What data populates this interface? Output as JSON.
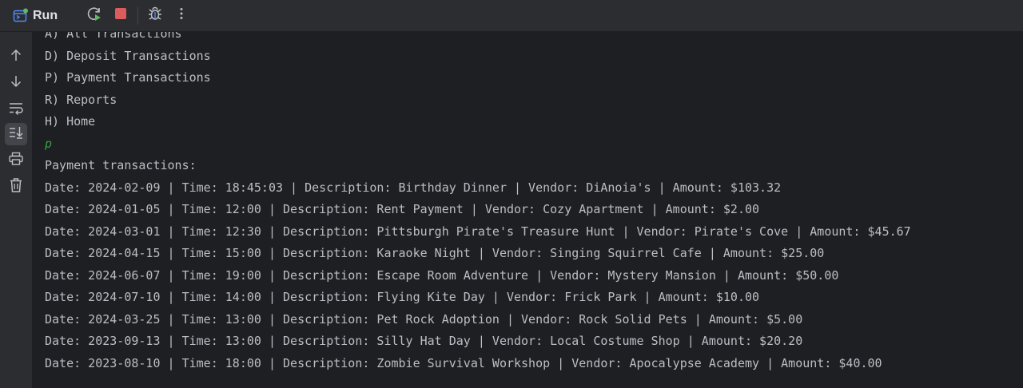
{
  "toolbar": {
    "run_label": "Run",
    "buttons": [
      {
        "name": "rerun",
        "icon": "rerun-icon"
      },
      {
        "name": "stop",
        "icon": "stop-icon"
      },
      {
        "name": "debug",
        "icon": "bug-icon"
      },
      {
        "name": "more",
        "icon": "more-vertical-icon"
      }
    ]
  },
  "gutter": {
    "buttons": [
      {
        "name": "scroll-up",
        "icon": "arrow-up-icon"
      },
      {
        "name": "scroll-down",
        "icon": "arrow-down-icon"
      },
      {
        "name": "soft-wrap",
        "icon": "soft-wrap-icon"
      },
      {
        "name": "scroll-to-end",
        "icon": "scroll-to-end-icon",
        "active": true
      },
      {
        "name": "print",
        "icon": "printer-icon"
      },
      {
        "name": "clear",
        "icon": "trash-icon"
      }
    ]
  },
  "console": {
    "menu_lines": [
      "A) All Transactions",
      "D) Deposit Transactions",
      "P) Payment Transactions",
      "R) Reports",
      "H) Home"
    ],
    "user_input": "p",
    "header": "Payment transactions:",
    "transactions": [
      "Date: 2024-02-09 | Time: 18:45:03 | Description: Birthday Dinner | Vendor: DiAnoia's | Amount: $103.32",
      "Date: 2024-01-05 | Time: 12:00 | Description: Rent Payment | Vendor: Cozy Apartment | Amount: $2.00",
      "Date: 2024-03-01 | Time: 12:30 | Description: Pittsburgh Pirate's Treasure Hunt | Vendor: Pirate's Cove | Amount: $45.67",
      "Date: 2024-04-15 | Time: 15:00 | Description: Karaoke Night | Vendor: Singing Squirrel Cafe | Amount: $25.00",
      "Date: 2024-06-07 | Time: 19:00 | Description: Escape Room Adventure | Vendor: Mystery Mansion | Amount: $50.00",
      "Date: 2024-07-10 | Time: 14:00 | Description: Flying Kite Day | Vendor: Frick Park | Amount: $10.00",
      "Date: 2024-03-25 | Time: 13:00 | Description: Pet Rock Adoption | Vendor: Rock Solid Pets | Amount: $5.00",
      "Date: 2023-09-13 | Time: 13:00 | Description: Silly Hat Day | Vendor: Local Costume Shop | Amount: $20.20",
      "Date: 2023-08-10 | Time: 18:00 | Description: Zombie Survival Workshop | Vendor: Apocalypse Academy | Amount: $40.00"
    ]
  },
  "colors": {
    "background": "#1e1f22",
    "panel": "#2b2d30",
    "text": "#bcbec4",
    "input_text": "#2fa043",
    "stop": "#db5c5c",
    "run_green": "#5fb865",
    "run_blue": "#548af7"
  }
}
